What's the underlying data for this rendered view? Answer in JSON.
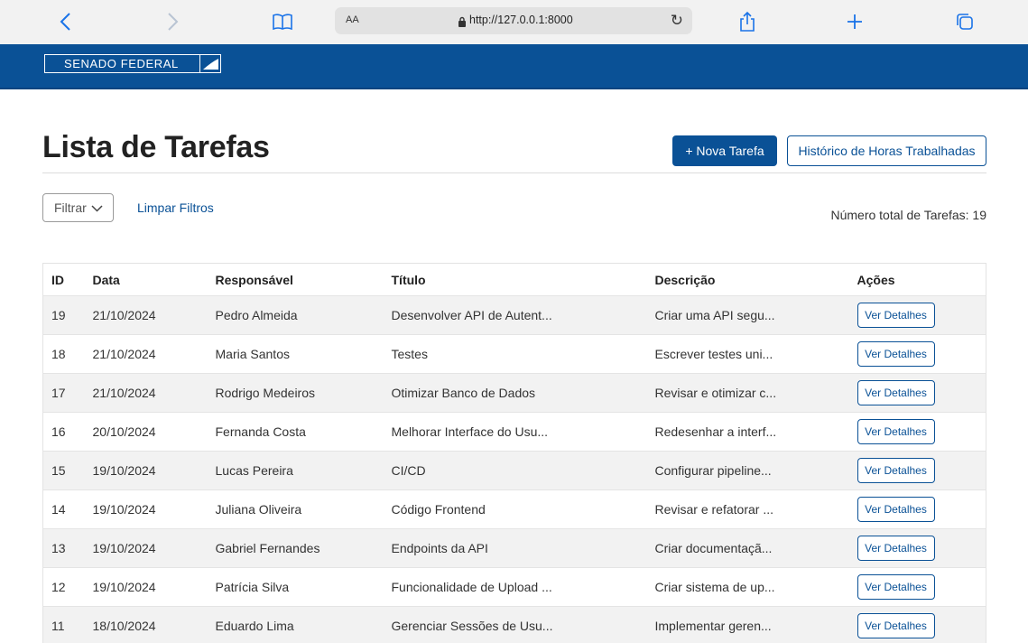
{
  "browser": {
    "text_size_label": "AA",
    "url": "http://127.0.0.1:8000"
  },
  "header": {
    "logo_text": "SENADO FEDERAL"
  },
  "main": {
    "title": "Lista de Tarefas",
    "new_task_label": "+ Nova Tarefa",
    "history_label": "Histórico de Horas Trabalhadas",
    "filter_label": "Filtrar",
    "clear_filters_label": "Limpar Filtros",
    "total_label": "Número total de Tarefas: 19"
  },
  "table": {
    "columns": [
      "ID",
      "Data",
      "Responsável",
      "Título",
      "Descrição",
      "Ações"
    ],
    "action_label": "Ver Detalhes",
    "rows": [
      {
        "id": "19",
        "date": "21/10/2024",
        "owner": "Pedro Almeida",
        "title": "Desenvolver API de Autent...",
        "description": "Criar uma API segu..."
      },
      {
        "id": "18",
        "date": "21/10/2024",
        "owner": "Maria Santos",
        "title": "Testes",
        "description": "Escrever testes uni..."
      },
      {
        "id": "17",
        "date": "21/10/2024",
        "owner": "Rodrigo Medeiros",
        "title": "Otimizar Banco de Dados",
        "description": "Revisar e otimizar c..."
      },
      {
        "id": "16",
        "date": "20/10/2024",
        "owner": "Fernanda Costa",
        "title": "Melhorar Interface do Usu...",
        "description": "Redesenhar a interf..."
      },
      {
        "id": "15",
        "date": "19/10/2024",
        "owner": "Lucas Pereira",
        "title": "CI/CD",
        "description": "Configurar pipeline..."
      },
      {
        "id": "14",
        "date": "19/10/2024",
        "owner": "Juliana Oliveira",
        "title": "Código Frontend",
        "description": "Revisar e refatorar ..."
      },
      {
        "id": "13",
        "date": "19/10/2024",
        "owner": "Gabriel Fernandes",
        "title": "Endpoints da API",
        "description": "Criar documentaçã..."
      },
      {
        "id": "12",
        "date": "19/10/2024",
        "owner": "Patrícia Silva",
        "title": "Funcionalidade de Upload ...",
        "description": "Criar sistema de up..."
      },
      {
        "id": "11",
        "date": "18/10/2024",
        "owner": "Eduardo Lima",
        "title": "Gerenciar Sessões de Usu...",
        "description": "Implementar geren..."
      }
    ]
  },
  "colors": {
    "brand_blue": "#0a5196",
    "browser_accent": "#1a73e8",
    "row_stripe": "#f2f2f2"
  },
  "icons": [
    "back-icon",
    "forward-icon",
    "bookmarks-icon",
    "lock-icon",
    "reload-icon",
    "share-icon",
    "new-tab-icon",
    "tabs-icon",
    "senate-logo-icon",
    "chevron-down-icon"
  ]
}
